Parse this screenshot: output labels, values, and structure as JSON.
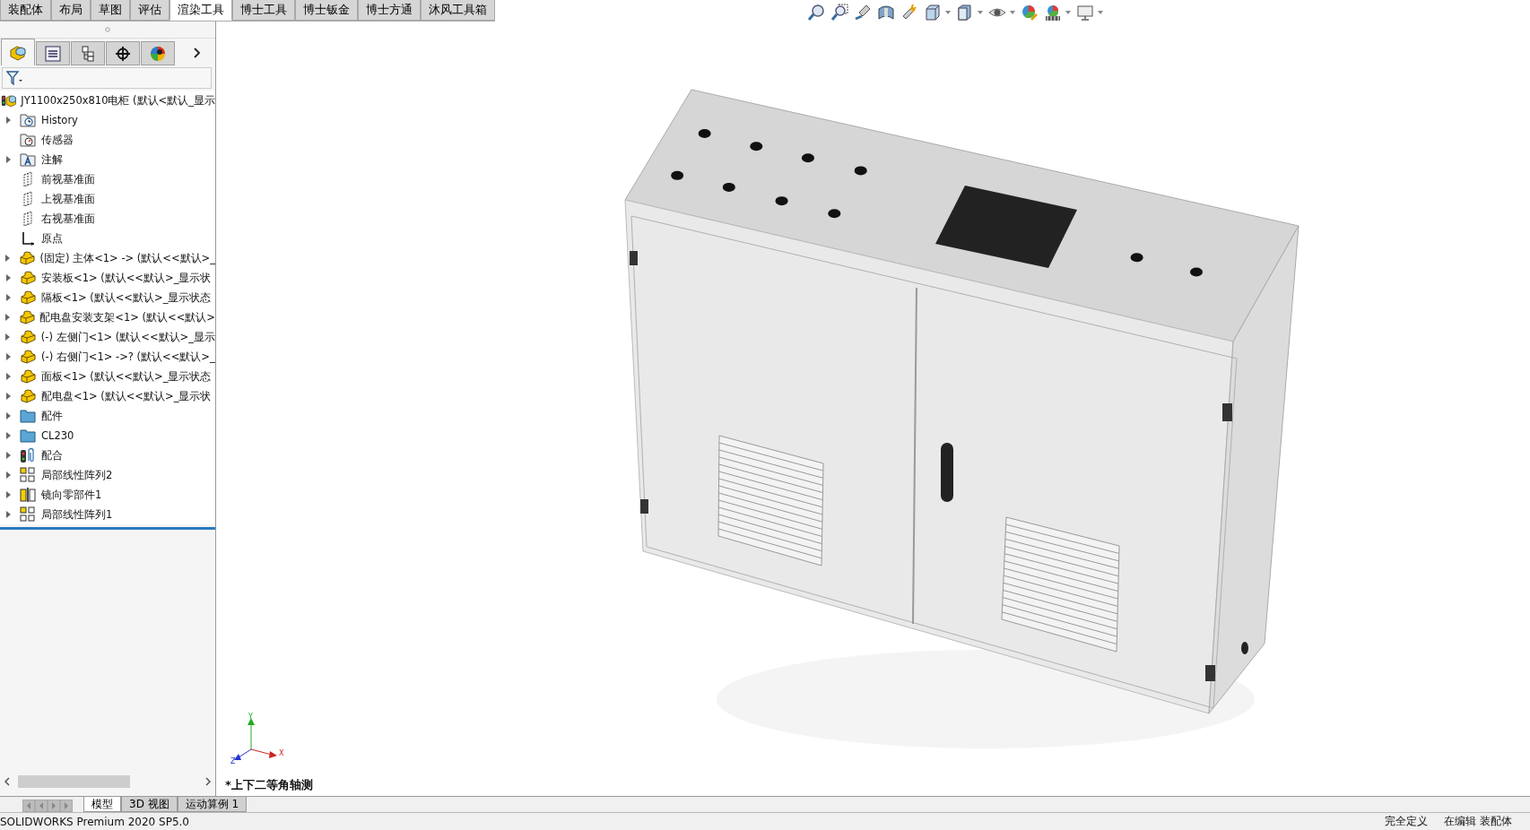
{
  "command_tabs": [
    {
      "label": "装配体",
      "selected": false
    },
    {
      "label": "布局",
      "selected": false
    },
    {
      "label": "草图",
      "selected": false
    },
    {
      "label": "评估",
      "selected": false
    },
    {
      "label": "渲染工具",
      "selected": true
    },
    {
      "label": "博士工具",
      "selected": false
    },
    {
      "label": "博士钣金",
      "selected": false
    },
    {
      "label": "博士方通",
      "selected": false
    },
    {
      "label": "沐风工具箱",
      "selected": false
    }
  ],
  "panel_tabs": [
    {
      "kind": "feature-tree",
      "selected": true
    },
    {
      "kind": "property",
      "selected": false
    },
    {
      "kind": "config",
      "selected": false
    },
    {
      "kind": "dimxpert",
      "selected": false
    },
    {
      "kind": "display",
      "selected": false
    }
  ],
  "feature_tree": {
    "label": "JY1100x250x810电柜  (默认<默认_显示",
    "kind": "assembly",
    "children": [
      {
        "label": "History",
        "kind": "history",
        "expandable": true
      },
      {
        "label": "传感器",
        "kind": "sensor",
        "expandable": false
      },
      {
        "label": "注解",
        "kind": "annotation",
        "expandable": true
      },
      {
        "label": "前视基准面",
        "kind": "plane",
        "expandable": false
      },
      {
        "label": "上视基准面",
        "kind": "plane",
        "expandable": false
      },
      {
        "label": "右视基准面",
        "kind": "plane",
        "expandable": false
      },
      {
        "label": "原点",
        "kind": "origin",
        "expandable": false
      },
      {
        "label": "(固定) 主体<1> -> (默认<<默认>_",
        "kind": "part",
        "expandable": true
      },
      {
        "label": "安装板<1> (默认<<默认>_显示状",
        "kind": "part",
        "expandable": true
      },
      {
        "label": "隔板<1> (默认<<默认>_显示状态",
        "kind": "part",
        "expandable": true
      },
      {
        "label": "配电盘安装支架<1> (默认<<默认>",
        "kind": "part",
        "expandable": true
      },
      {
        "label": "(-) 左侧门<1> (默认<<默认>_显示",
        "kind": "part",
        "expandable": true
      },
      {
        "label": "(-) 右侧门<1> ->? (默认<<默认>_",
        "kind": "part",
        "expandable": true
      },
      {
        "label": "面板<1> (默认<<默认>_显示状态",
        "kind": "part",
        "expandable": true
      },
      {
        "label": "配电盘<1> (默认<<默认>_显示状",
        "kind": "part",
        "expandable": true
      },
      {
        "label": "配件",
        "kind": "folder",
        "expandable": true
      },
      {
        "label": "CL230",
        "kind": "folder",
        "expandable": true
      },
      {
        "label": "配合",
        "kind": "mates",
        "expandable": true
      },
      {
        "label": "局部线性阵列2",
        "kind": "pattern",
        "expandable": true
      },
      {
        "label": "镜向零部件1",
        "kind": "mirror",
        "expandable": true
      },
      {
        "label": "局部线性阵列1",
        "kind": "pattern",
        "expandable": true
      }
    ]
  },
  "triad": {
    "x": "X",
    "y": "Y",
    "z": "Z"
  },
  "view_label": "*上下二等角轴测",
  "bottom_tabs": [
    {
      "label": "模型",
      "selected": true
    },
    {
      "label": "3D 视图",
      "selected": false
    },
    {
      "label": "运动算例 1",
      "selected": false
    }
  ],
  "status_bar": {
    "product": "SOLIDWORKS Premium 2020 SP5.0",
    "definition": "完全定义",
    "mode": "在编辑 装配体"
  }
}
